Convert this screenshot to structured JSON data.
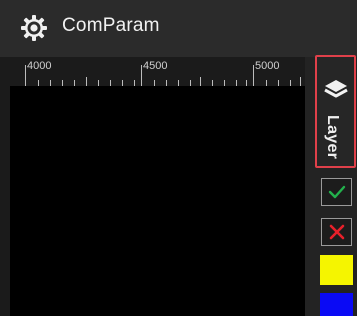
{
  "window": {
    "title": "ComParam",
    "icon": "gear-icon"
  },
  "ruler": {
    "labels": [
      "4000",
      "4500",
      "5000"
    ]
  },
  "layer_panel": {
    "label": "Layer",
    "icon": "layers-icon",
    "accent_color": "#e0404a"
  },
  "controls": {
    "confirm_icon": "check-icon",
    "cancel_icon": "close-icon",
    "confirm_color": "#22b14c",
    "cancel_color": "#e8202a"
  },
  "swatches": [
    {
      "name": "yellow",
      "color": "#f5f500"
    },
    {
      "name": "blue",
      "color": "#0a0af5"
    }
  ]
}
